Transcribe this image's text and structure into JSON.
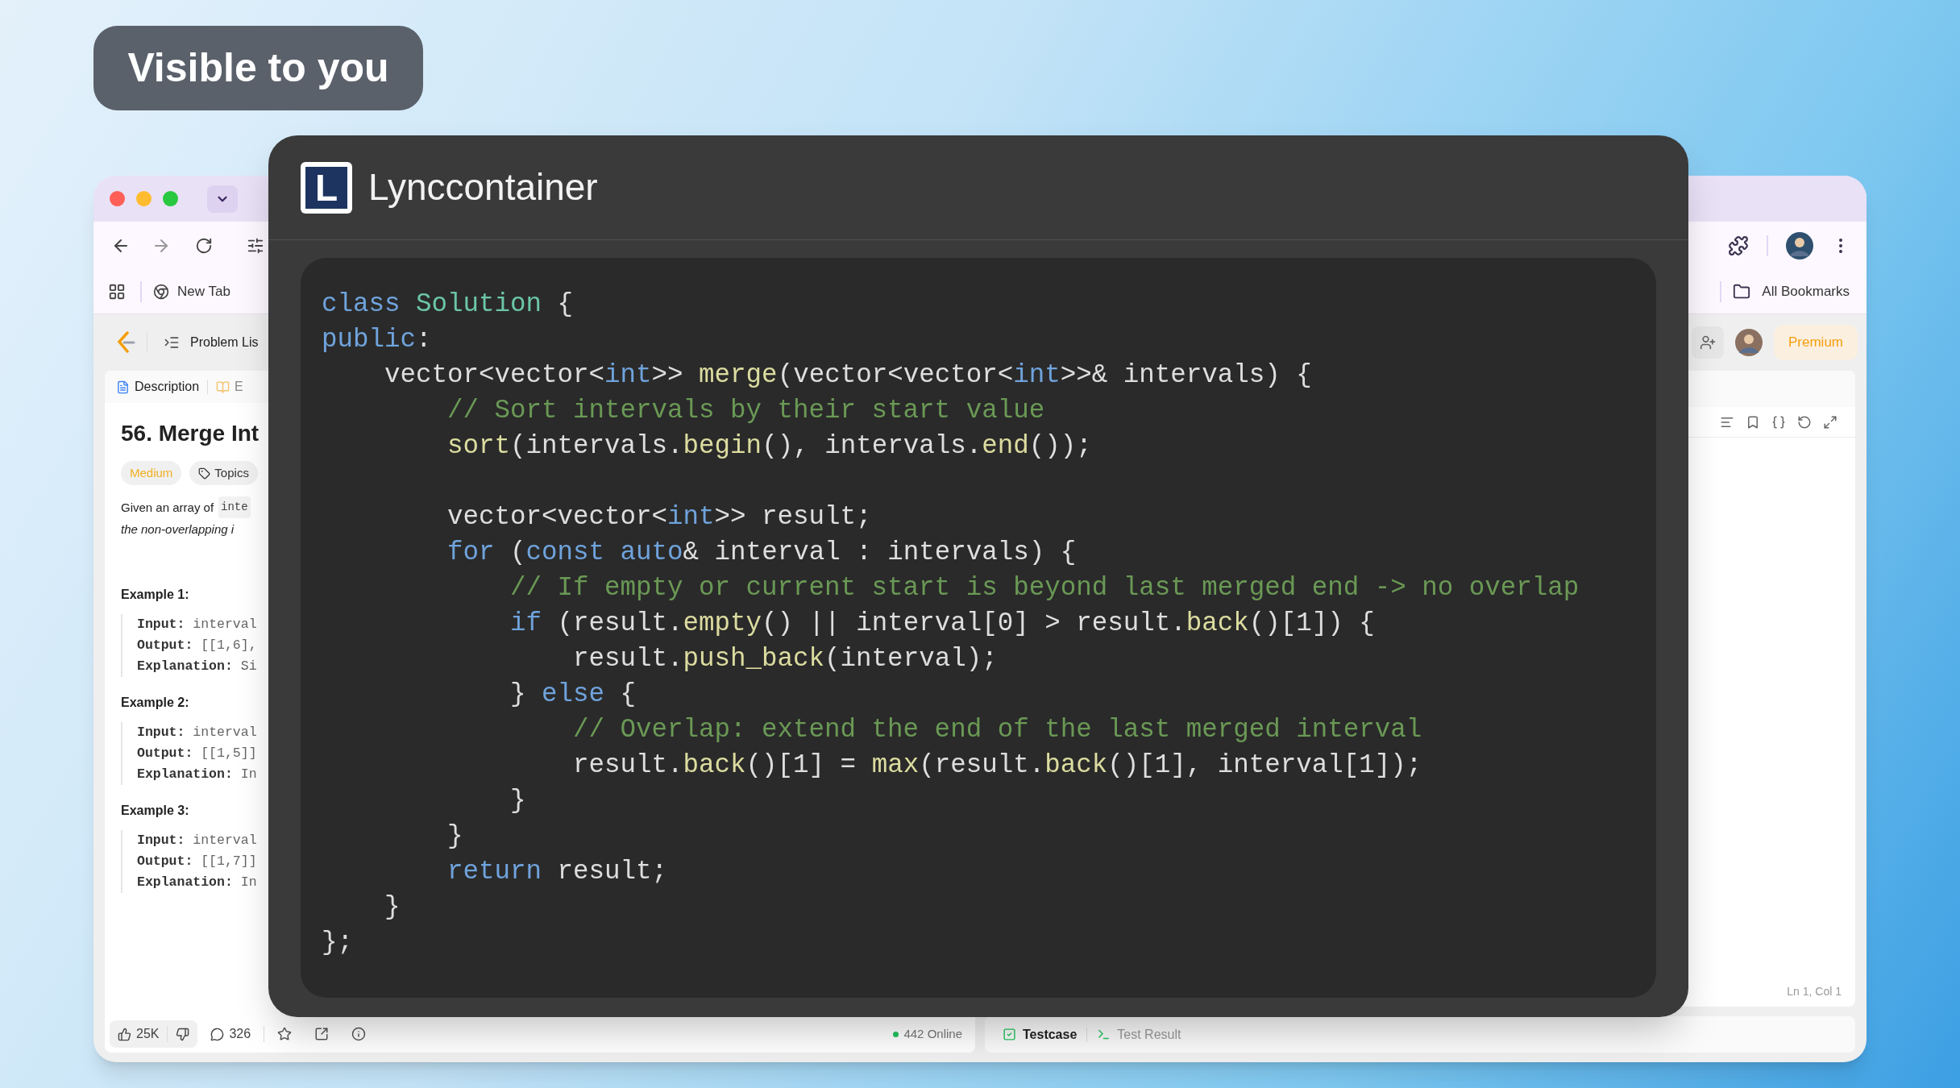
{
  "badge": "Visible to you",
  "browser": {
    "bookmarks": [
      "New Tab"
    ],
    "all_bookmarks": "All Bookmarks"
  },
  "app": {
    "nav_label": "Problem Lis",
    "premium": "Premium",
    "tabs": [
      {
        "label": "Description",
        "selected": true
      },
      {
        "label": "E",
        "selected": false
      }
    ],
    "title": "56. Merge Int",
    "tags": [
      "Medium",
      "Topics"
    ],
    "paragraph": {
      "text": "Given an array of",
      "code": "inte",
      "italic": "the non-overlapping i"
    },
    "examples": [
      {
        "title": "Example 1:",
        "lines": [
          {
            "label": "Input:",
            "value": "interval"
          },
          {
            "label": "Output:",
            "value": "[[1,6],"
          },
          {
            "label": "Explanation:",
            "value": "Si"
          }
        ]
      },
      {
        "title": "Example 2:",
        "lines": [
          {
            "label": "Input:",
            "value": "interval"
          },
          {
            "label": "Output:",
            "value": "[[1,5]]"
          },
          {
            "label": "Explanation:",
            "value": "In"
          }
        ]
      },
      {
        "title": "Example 3:",
        "lines": [
          {
            "label": "Input:",
            "value": "interval"
          },
          {
            "label": "Output:",
            "value": "[[1,7]]"
          },
          {
            "label": "Explanation:",
            "value": "In"
          }
        ]
      }
    ],
    "footer": {
      "likes": "25K",
      "comments": "326",
      "online": "442 Online"
    },
    "editor": {
      "cursor": "Ln 1, Col 1"
    },
    "console_tabs": [
      {
        "label": "Testcase",
        "selected": true
      },
      {
        "label": "Test Result",
        "selected": false
      }
    ]
  },
  "overlay": {
    "logo_letter": "L",
    "title": "Lynccontainer",
    "code": [
      {
        "tokens": [
          {
            "kind": "keyword",
            "text": "class "
          },
          {
            "kind": "type",
            "text": "Solution"
          },
          {
            "kind": "plain",
            "text": " {"
          }
        ]
      },
      {
        "tokens": [
          {
            "kind": "keyword",
            "text": "public"
          },
          {
            "kind": "plain",
            "text": ":"
          }
        ]
      },
      {
        "tokens": [
          {
            "kind": "plain",
            "text": "    vector<vector<"
          },
          {
            "kind": "keyword",
            "text": "int"
          },
          {
            "kind": "plain",
            "text": ">> "
          },
          {
            "kind": "func",
            "text": "merge"
          },
          {
            "kind": "plain",
            "text": "(vector<vector<"
          },
          {
            "kind": "keyword",
            "text": "int"
          },
          {
            "kind": "plain",
            "text": ">>& intervals) {"
          }
        ]
      },
      {
        "tokens": [
          {
            "kind": "comment",
            "text": "        // Sort intervals by their start value"
          }
        ]
      },
      {
        "tokens": [
          {
            "kind": "func",
            "text": "        sort"
          },
          {
            "kind": "plain",
            "text": "(intervals."
          },
          {
            "kind": "func",
            "text": "begin"
          },
          {
            "kind": "plain",
            "text": "(), intervals."
          },
          {
            "kind": "func",
            "text": "end"
          },
          {
            "kind": "plain",
            "text": "());"
          }
        ]
      },
      {
        "kind": "blank"
      },
      {
        "tokens": [
          {
            "kind": "plain",
            "text": "        vector<vector<"
          },
          {
            "kind": "keyword",
            "text": "int"
          },
          {
            "kind": "plain",
            "text": ">> result;"
          }
        ]
      },
      {
        "tokens": [
          {
            "kind": "keyword",
            "text": "        for"
          },
          {
            "kind": "plain",
            "text": " ("
          },
          {
            "kind": "keyword",
            "text": "const auto"
          },
          {
            "kind": "plain",
            "text": "& interval : intervals) {"
          }
        ]
      },
      {
        "tokens": [
          {
            "kind": "comment",
            "text": "            // If empty or current start is beyond last merged end -> no overlap"
          }
        ]
      },
      {
        "tokens": [
          {
            "kind": "keyword",
            "text": "            if"
          },
          {
            "kind": "plain",
            "text": " (result."
          },
          {
            "kind": "func",
            "text": "empty"
          },
          {
            "kind": "plain",
            "text": "() || interval[0] > result."
          },
          {
            "kind": "func",
            "text": "back"
          },
          {
            "kind": "plain",
            "text": "()[1]) {"
          }
        ]
      },
      {
        "tokens": [
          {
            "kind": "plain",
            "text": "                result."
          },
          {
            "kind": "func",
            "text": "push_back"
          },
          {
            "kind": "plain",
            "text": "(interval);"
          }
        ]
      },
      {
        "tokens": [
          {
            "kind": "plain",
            "text": "            } "
          },
          {
            "kind": "keyword",
            "text": "else"
          },
          {
            "kind": "plain",
            "text": " {"
          }
        ]
      },
      {
        "tokens": [
          {
            "kind": "comment",
            "text": "                // Overlap: extend the end of the last merged interval"
          }
        ]
      },
      {
        "tokens": [
          {
            "kind": "plain",
            "text": "                result."
          },
          {
            "kind": "func",
            "text": "back"
          },
          {
            "kind": "plain",
            "text": "()[1] = "
          },
          {
            "kind": "func",
            "text": "max"
          },
          {
            "kind": "plain",
            "text": "(result."
          },
          {
            "kind": "func",
            "text": "back"
          },
          {
            "kind": "plain",
            "text": "()[1], interval[1]);"
          }
        ]
      },
      {
        "tokens": [
          {
            "kind": "plain",
            "text": "            }"
          }
        ]
      },
      {
        "tokens": [
          {
            "kind": "plain",
            "text": "        }"
          }
        ]
      },
      {
        "tokens": [
          {
            "kind": "keyword",
            "text": "        return"
          },
          {
            "kind": "plain",
            "text": " result;"
          }
        ]
      },
      {
        "tokens": [
          {
            "kind": "plain",
            "text": "    }"
          }
        ]
      },
      {
        "tokens": [
          {
            "kind": "plain",
            "text": "};"
          }
        ]
      }
    ]
  }
}
